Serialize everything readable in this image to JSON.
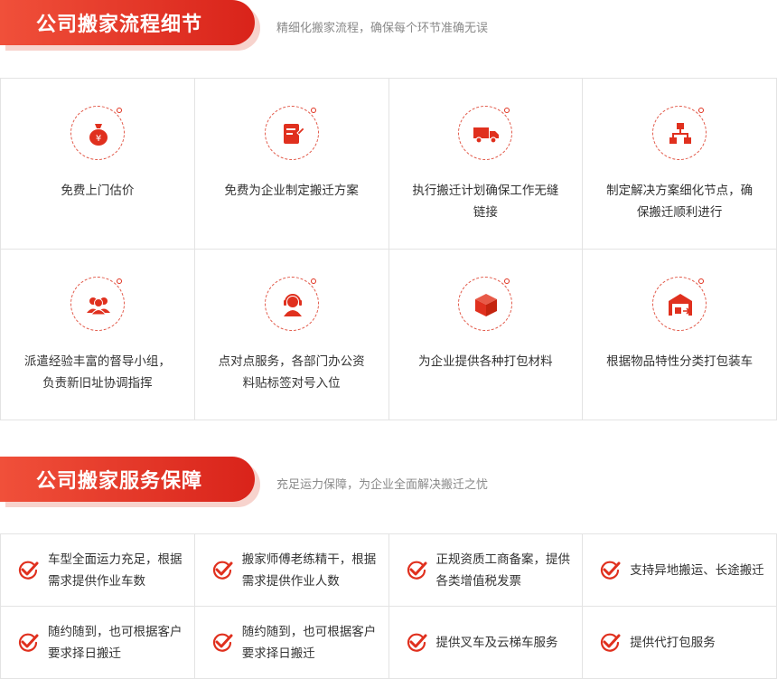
{
  "section1": {
    "title": "公司搬家流程细节",
    "subtitle": "精细化搬家流程，确保每个环节准确无误",
    "items": [
      {
        "icon": "money-bag-icon",
        "text": "免费上门估价"
      },
      {
        "icon": "document-edit-icon",
        "text": "免费为企业制定搬迁方案"
      },
      {
        "icon": "truck-icon",
        "text": "执行搬迁计划确保工作无缝链接"
      },
      {
        "icon": "flowchart-icon",
        "text": "制定解决方案细化节点，确保搬迁顺利进行"
      },
      {
        "icon": "team-icon",
        "text": "派遣经验丰富的督导小组，负责新旧址协调指挥"
      },
      {
        "icon": "headset-agent-icon",
        "text": "点对点服务，各部门办公资料贴标签对号入位"
      },
      {
        "icon": "package-box-icon",
        "text": "为企业提供各种打包材料"
      },
      {
        "icon": "warehouse-icon",
        "text": "根据物品特性分类打包装车"
      }
    ]
  },
  "section2": {
    "title": "公司搬家服务保障",
    "subtitle": "充足运力保障，为企业全面解决搬迁之忧",
    "items": [
      {
        "text": "车型全面运力充足，根据需求提供作业车数"
      },
      {
        "text": "搬家师傅老练精干，根据需求提供作业人数"
      },
      {
        "text": "正规资质工商备案，提供各类增值税发票"
      },
      {
        "text": "支持异地搬运、长途搬迁"
      },
      {
        "text": "随约随到，也可根据客户要求择日搬迁"
      },
      {
        "text": "随约随到，也可根据客户要求择日搬迁"
      },
      {
        "text": "提供叉车及云梯车服务"
      },
      {
        "text": "提供代打包服务"
      }
    ]
  },
  "colors": {
    "accent": "#e0301e",
    "banner_start": "#f0503a",
    "banner_end": "#d9231a"
  }
}
